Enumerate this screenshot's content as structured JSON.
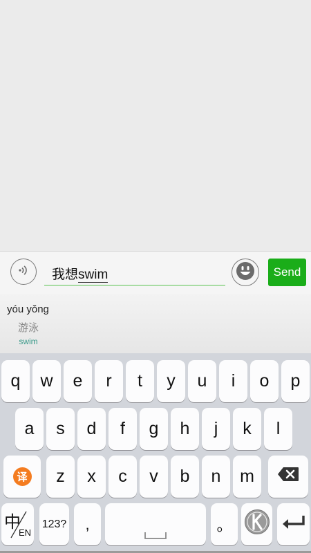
{
  "input": {
    "prefix": "我想",
    "composing": "swim",
    "send_label": "Send"
  },
  "candidate": {
    "pinyin": "yóu yǒng",
    "hanzi": "游泳",
    "translation": "swim"
  },
  "keyboard": {
    "row1": [
      "q",
      "w",
      "e",
      "r",
      "t",
      "y",
      "u",
      "i",
      "o",
      "p"
    ],
    "row2": [
      "a",
      "s",
      "d",
      "f",
      "g",
      "h",
      "j",
      "k",
      "l"
    ],
    "row3": [
      "z",
      "x",
      "c",
      "v",
      "b",
      "n",
      "m"
    ],
    "translate_label": "译",
    "lang_main": "中",
    "lang_alt": "EN",
    "num_label": "123?",
    "comma_label": ",",
    "period_label": "。"
  },
  "colors": {
    "send_bg": "#1aad19",
    "field_underline": "#55c04b",
    "translate_badge": "#f47c20"
  }
}
